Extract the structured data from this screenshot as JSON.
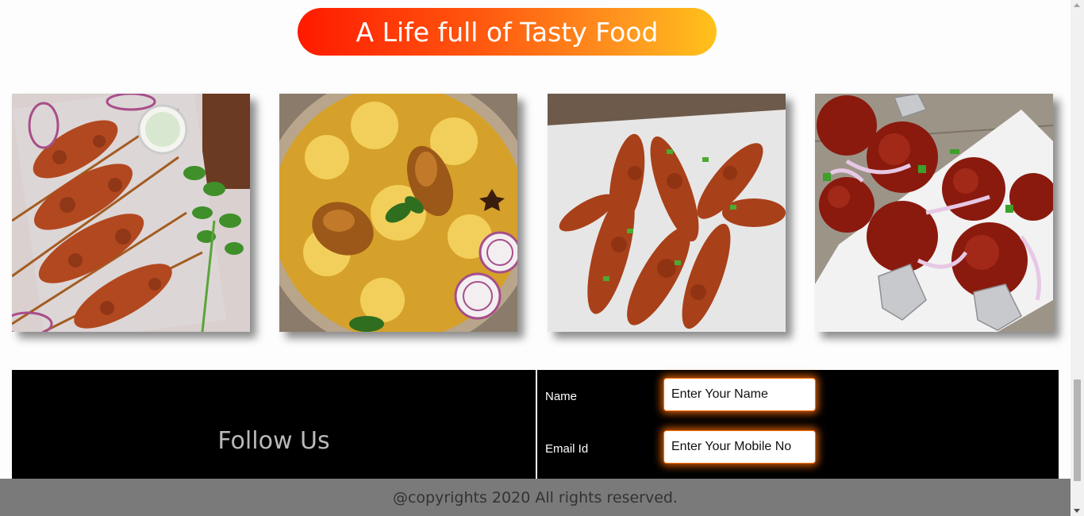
{
  "banner": {
    "title": "A Life full of Tasty Food"
  },
  "gallery": [
    {
      "name": "chicken-kebab-image"
    },
    {
      "name": "chicken-biryani-image"
    },
    {
      "name": "fried-chicken-image"
    },
    {
      "name": "chilli-chicken-lollipop-image"
    }
  ],
  "contact": {
    "follow_us": "Follow Us",
    "name_label": "Name",
    "name_placeholder": "Enter Your Name",
    "email_label": "Email Id",
    "email_placeholder": "Enter Your Mobile No"
  },
  "footer": {
    "copyright": "@copyrights 2020 All rights reserved."
  },
  "colors": {
    "banner_start": "#ff1a00",
    "banner_end": "#ffc21a",
    "input_glow": "#ff6a00",
    "footer_bg": "#7a7a7a",
    "contact_bg": "#000000"
  }
}
